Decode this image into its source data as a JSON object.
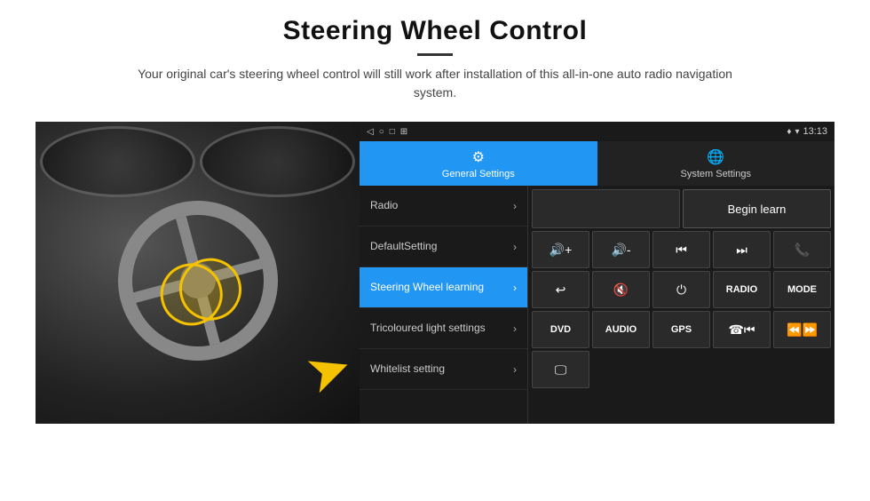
{
  "header": {
    "title": "Steering Wheel Control",
    "subtitle": "Your original car's steering wheel control will still work after installation of this all-in-one auto radio navigation system."
  },
  "statusBar": {
    "time": "13:13",
    "icons": [
      "◁",
      "○",
      "□",
      "⊞"
    ]
  },
  "tabs": [
    {
      "id": "general",
      "icon": "⚙",
      "label": "General Settings",
      "active": true
    },
    {
      "id": "system",
      "icon": "🌐",
      "label": "System Settings",
      "active": false
    }
  ],
  "menu": {
    "items": [
      {
        "id": "radio",
        "label": "Radio",
        "active": false
      },
      {
        "id": "default",
        "label": "DefaultSetting",
        "active": false
      },
      {
        "id": "steering",
        "label": "Steering Wheel learning",
        "active": true
      },
      {
        "id": "tricoloured",
        "label": "Tricoloured light settings",
        "active": false
      },
      {
        "id": "whitelist",
        "label": "Whitelist setting",
        "active": false
      }
    ]
  },
  "controls": {
    "beginLearn": "Begin learn",
    "row2": [
      "🔊+",
      "🔊-",
      "⏮",
      "⏭",
      "📞"
    ],
    "row2_symbols": [
      "◀+",
      "◀-",
      "⏮⏮",
      "⏭⏭",
      "☎"
    ],
    "row3": [
      "↩",
      "🔇",
      "⏻",
      "RADIO",
      "MODE"
    ],
    "row4": [
      "DVD",
      "AUDIO",
      "GPS",
      "☎⏮",
      "⏪⏩"
    ],
    "row5": [
      "🖵"
    ]
  }
}
